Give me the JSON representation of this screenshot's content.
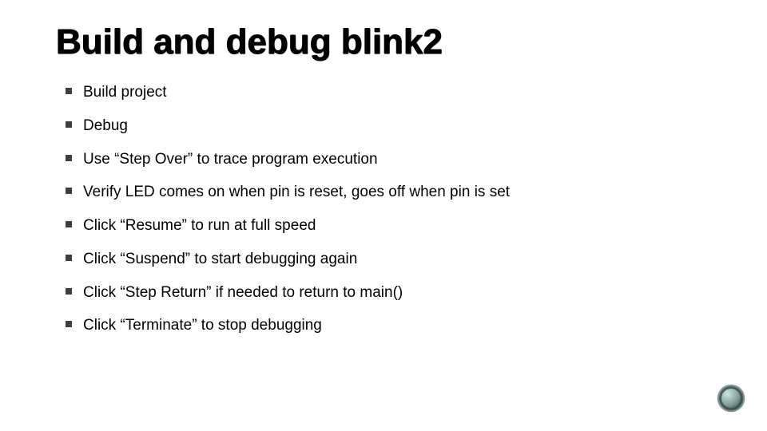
{
  "title": "Build and debug blink2",
  "bullets": [
    "Build project",
    "Debug",
    "Use “Step Over” to trace program execution",
    "Verify LED comes on when pin is reset, goes off when pin is set",
    "Click “Resume” to run at full speed",
    "Click “Suspend” to start debugging again",
    "Click “Step Return” if needed to return to main()",
    "Click “Terminate” to stop debugging"
  ]
}
